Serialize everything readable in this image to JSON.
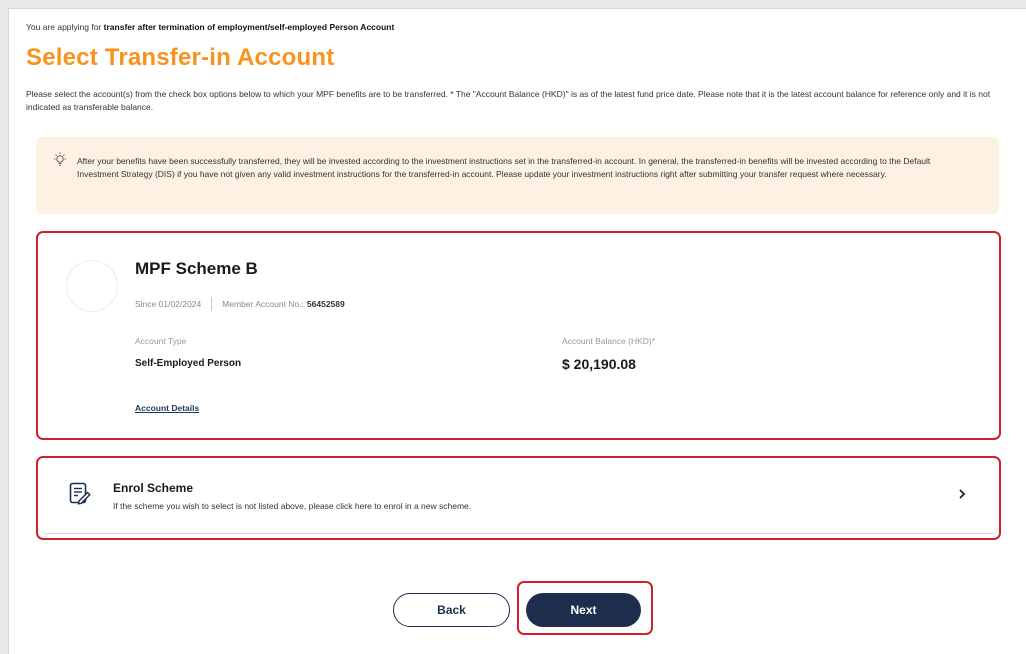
{
  "header": {
    "applying_prefix": "You are applying for ",
    "applying_type": "transfer after termination of employment/self-employed Person Account",
    "title": "Select Transfer-in Account",
    "description": "Please select the account(s) from the check box options below to which your MPF benefits are to be transferred. * The \"Account Balance (HKD)\" is as of the latest fund price date. Please note that it is the latest account balance for reference only and it is not indicated as transferable balance."
  },
  "notice": {
    "icon": "lightbulb-icon",
    "text": "After your benefits have been successfully transferred, they will be invested according to the investment instructions set in the transferred-in account. In general, the transferred-in benefits will be invested according to the Default Investment Strategy (DIS) if you have not given any valid investment instructions for the transferred-in account. Please update your investment instructions right after submitting your transfer request where necessary."
  },
  "account": {
    "scheme_name": "MPF Scheme B",
    "since": "Since 01/02/2024",
    "member_label": "Member Account No.:",
    "member_no": "56452589",
    "type_label": "Account Type",
    "type_value": "Self-Employed Person",
    "balance_label": "Account Balance (HKD)*",
    "balance_value": "$ 20,190.08",
    "details_link": "Account Details"
  },
  "enrol": {
    "icon": "edit-document-icon",
    "title": "Enrol Scheme",
    "subtitle": "If the scheme you wish to select is not listed above, please click here to enrol in a new scheme."
  },
  "actions": {
    "back_label": "Back",
    "next_label": "Next"
  },
  "colors": {
    "accent": "#f7931e",
    "primary": "#1e2f4d",
    "highlight": "#d0202a",
    "notice_bg": "#fdf1e4"
  }
}
